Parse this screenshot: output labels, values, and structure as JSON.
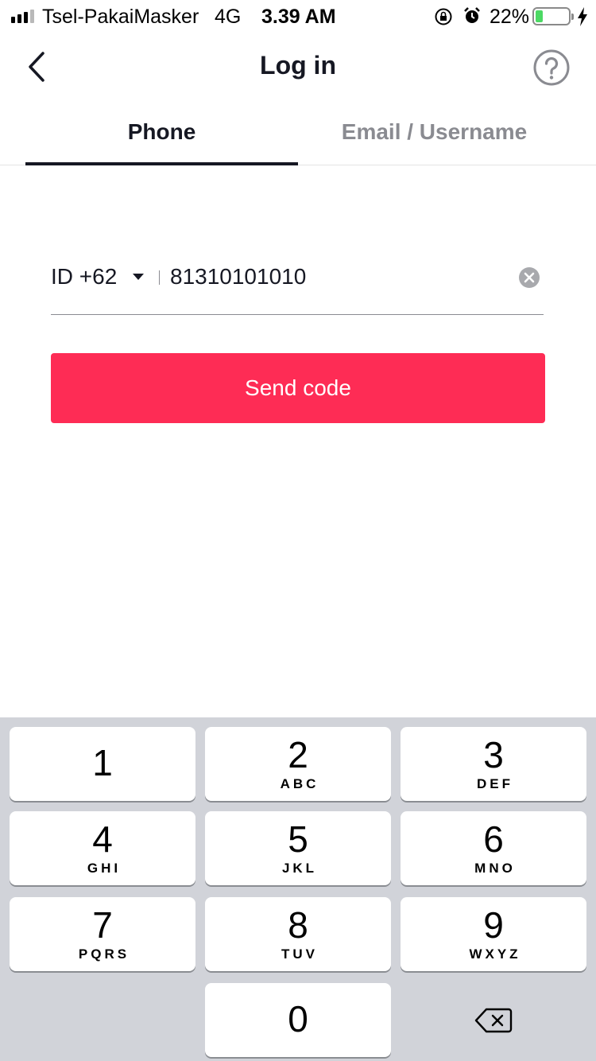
{
  "status_bar": {
    "carrier": "Tsel-PakaiMasker",
    "network": "4G",
    "time": "3.39 AM",
    "battery_percent": "22%",
    "battery_level": 0.22
  },
  "nav": {
    "title": "Log in",
    "back_icon": "chevron-left-icon",
    "help_icon": "question-circle-icon"
  },
  "tabs": [
    {
      "label": "Phone",
      "active": true
    },
    {
      "label": "Email / Username",
      "active": false
    }
  ],
  "phone_form": {
    "country_code": "ID +62",
    "phone_value": "81310101010",
    "send_label": "Send code"
  },
  "colors": {
    "accent": "#fe2c55",
    "text_primary": "#161823",
    "text_secondary": "#8a8b91",
    "keypad_bg": "#d1d3d9"
  },
  "keypad": [
    {
      "digit": "1",
      "letters": ""
    },
    {
      "digit": "2",
      "letters": "ABC"
    },
    {
      "digit": "3",
      "letters": "DEF"
    },
    {
      "digit": "4",
      "letters": "GHI"
    },
    {
      "digit": "5",
      "letters": "JKL"
    },
    {
      "digit": "6",
      "letters": "MNO"
    },
    {
      "digit": "7",
      "letters": "PQRS"
    },
    {
      "digit": "8",
      "letters": "TUV"
    },
    {
      "digit": "9",
      "letters": "WXYZ"
    },
    {
      "digit": "0",
      "letters": ""
    }
  ]
}
